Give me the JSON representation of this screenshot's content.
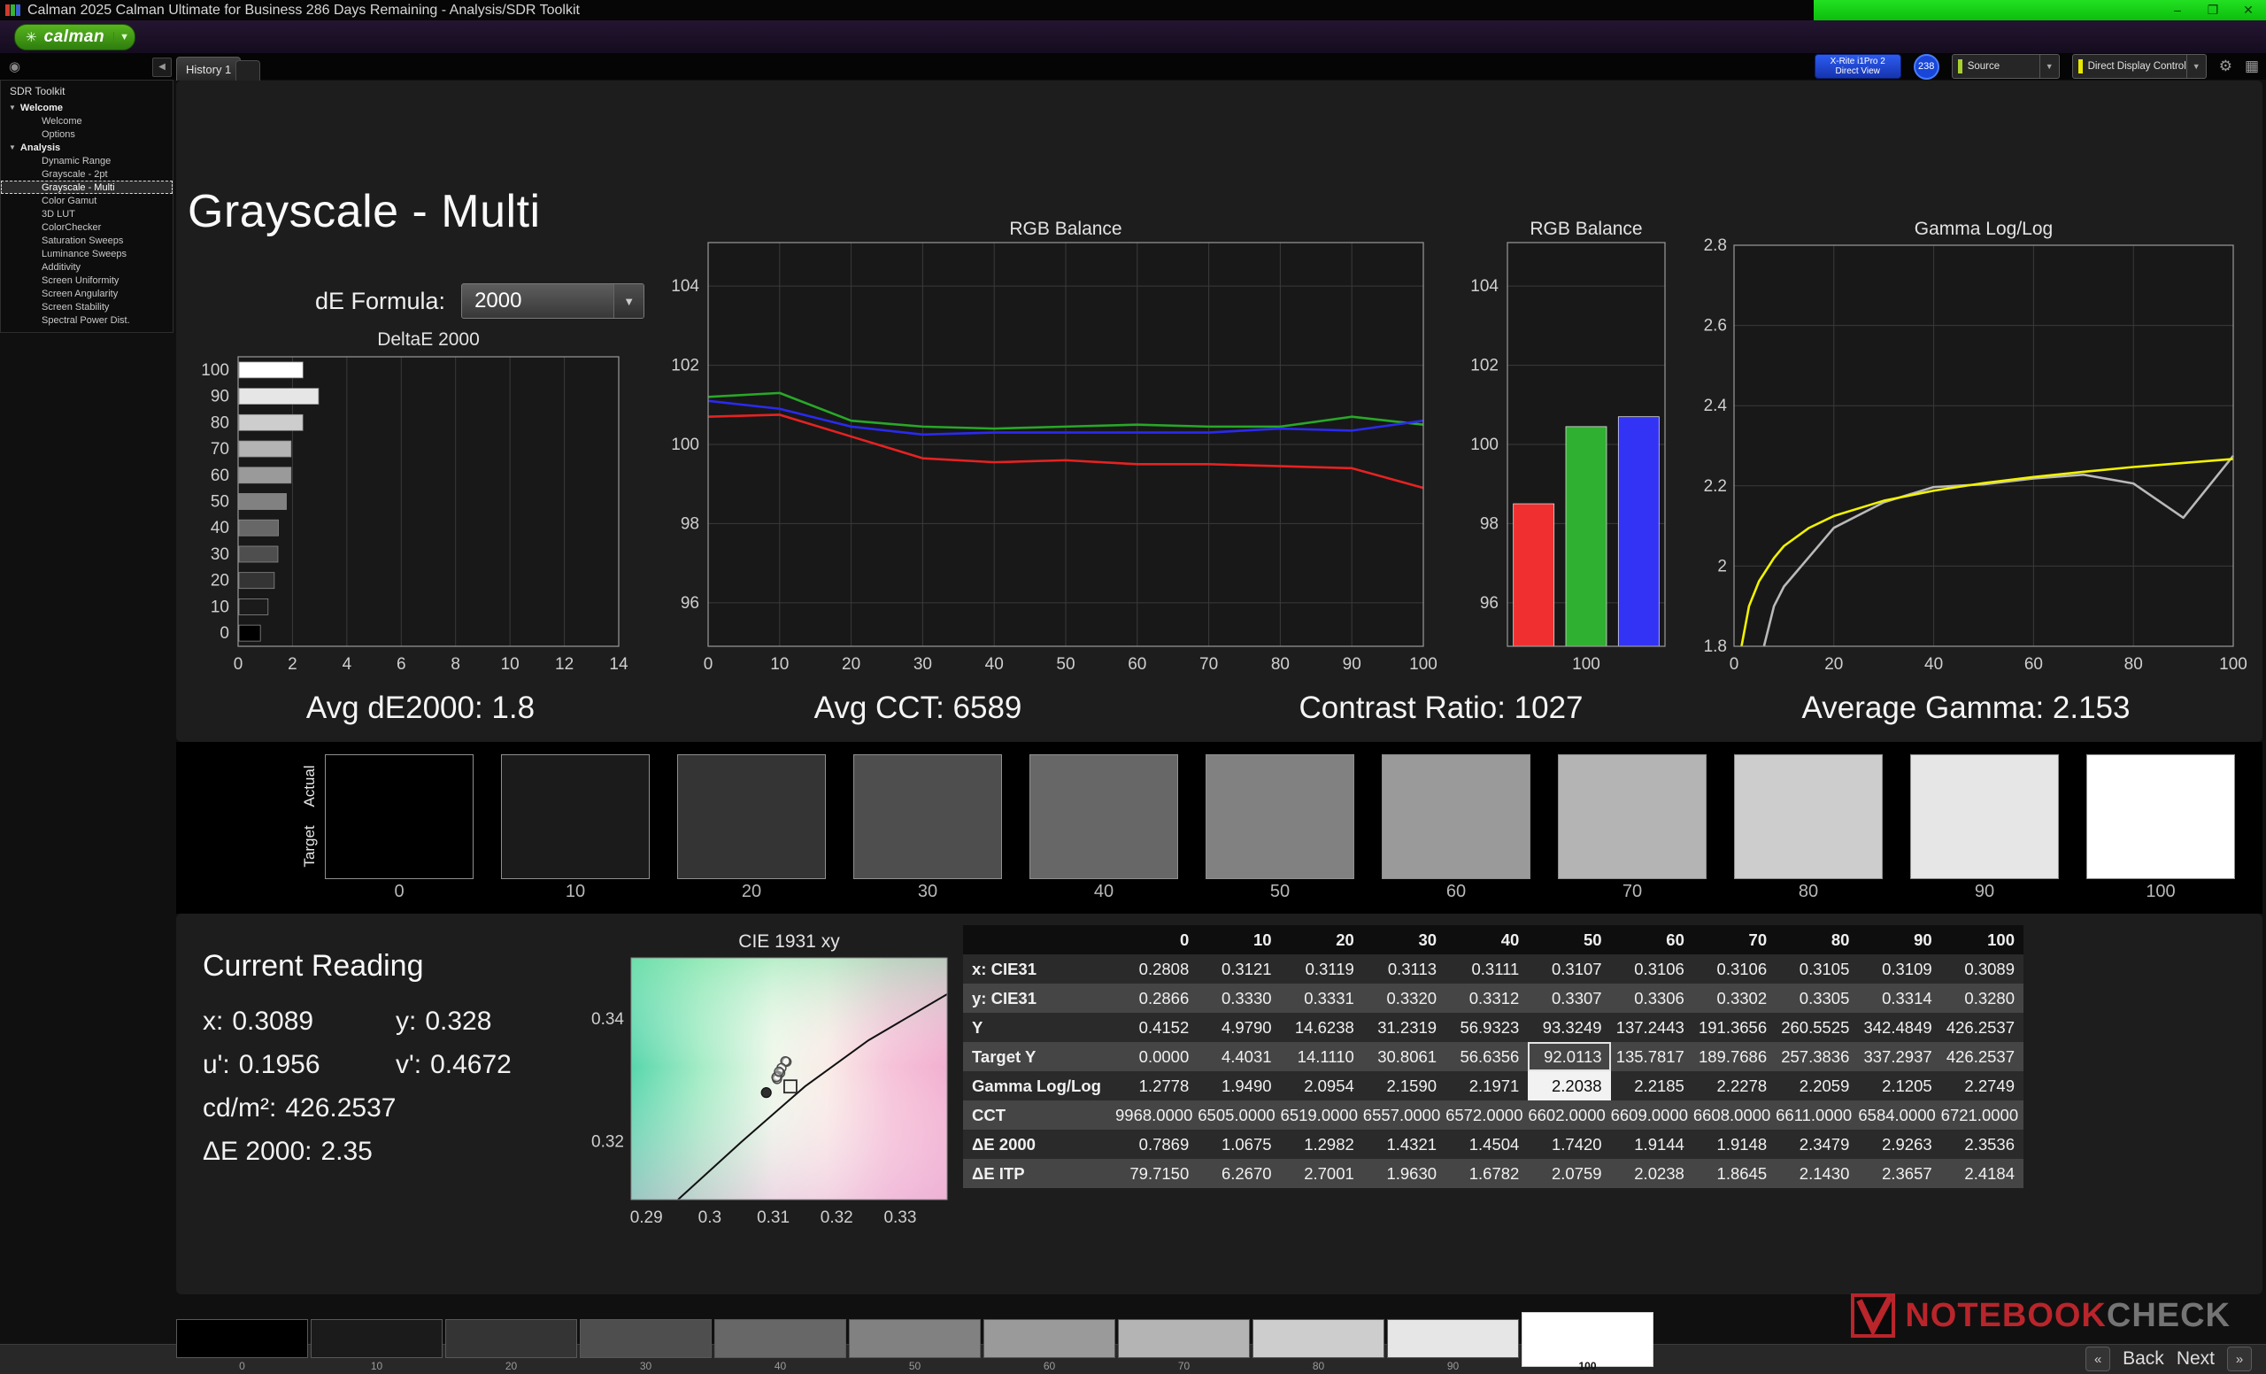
{
  "window": {
    "title": "Calman 2025 Calman Ultimate for Business 286 Days Remaining  - Analysis/SDR Toolkit",
    "minimize_glyph": "–",
    "maximize_glyph": "❐",
    "close_glyph": "✕"
  },
  "brand": {
    "logo_text": "calman",
    "accent_green": "#47a718"
  },
  "toolbar": {
    "history_tab": "History 1",
    "meter_button": {
      "line1": "X-Rite i1Pro 2",
      "line2": "Direct View"
    },
    "meter_badge": "238",
    "source_dropdown": "Source",
    "display_control_dropdown": "Direct Display Control",
    "source_indicator_color": "#a8d030",
    "display_indicator_color": "#e8e800"
  },
  "sidebar": {
    "title": "SDR Toolkit",
    "sections": [
      {
        "label": "Welcome",
        "items": [
          {
            "label": "Welcome"
          },
          {
            "label": "Options"
          }
        ]
      },
      {
        "label": "Analysis",
        "items": [
          {
            "label": "Dynamic Range"
          },
          {
            "label": "Grayscale - 2pt"
          },
          {
            "label": "Grayscale - Multi",
            "selected": true
          },
          {
            "label": "Color Gamut"
          },
          {
            "label": "3D LUT"
          },
          {
            "label": "ColorChecker"
          },
          {
            "label": "Saturation Sweeps"
          },
          {
            "label": "Luminance Sweeps"
          },
          {
            "label": "Additivity"
          },
          {
            "label": "Screen Uniformity"
          },
          {
            "label": "Screen Angularity"
          },
          {
            "label": "Screen Stability"
          },
          {
            "label": "Spectral Power Dist."
          }
        ]
      }
    ]
  },
  "page": {
    "title": "Grayscale - Multi",
    "de_formula_label": "dE Formula:",
    "de_formula_value": "2000"
  },
  "stats": [
    "Avg dE2000: 1.8",
    "Avg CCT: 6589",
    "Contrast Ratio: 1027",
    "Average Gamma: 2.153"
  ],
  "grayscale_strip": {
    "row_labels": [
      "Actual",
      "Target"
    ],
    "levels": [
      "0",
      "10",
      "20",
      "30",
      "40",
      "50",
      "60",
      "70",
      "80",
      "90",
      "100"
    ],
    "colors": [
      "#000000",
      "#1b1b1b",
      "#343434",
      "#4e4e4e",
      "#676767",
      "#818181",
      "#9a9a9a",
      "#b4b4b4",
      "#cdcdcd",
      "#e6e6e6",
      "#ffffff"
    ],
    "selected_level": "100"
  },
  "current_reading": {
    "title": "Current Reading",
    "rows": [
      [
        {
          "label": "x:",
          "value": "0.3089"
        },
        {
          "label": "y:",
          "value": "0.328"
        }
      ],
      [
        {
          "label": "u':",
          "value": "0.1956"
        },
        {
          "label": "v':",
          "value": "0.4672"
        }
      ],
      [
        {
          "label": "cd/m²:",
          "value": "426.2537"
        }
      ],
      [
        {
          "label": "ΔE 2000:",
          "value": "2.35"
        }
      ]
    ]
  },
  "table": {
    "columns": [
      "",
      "0",
      "10",
      "20",
      "30",
      "40",
      "50",
      "60",
      "70",
      "80",
      "90",
      "100"
    ],
    "rows": [
      {
        "label": "x: CIE31",
        "values": [
          "0.2808",
          "0.3121",
          "0.3119",
          "0.3113",
          "0.3111",
          "0.3107",
          "0.3106",
          "0.3106",
          "0.3105",
          "0.3109",
          "0.3089"
        ]
      },
      {
        "label": "y: CIE31",
        "values": [
          "0.2866",
          "0.3330",
          "0.3331",
          "0.3320",
          "0.3312",
          "0.3307",
          "0.3306",
          "0.3302",
          "0.3305",
          "0.3314",
          "0.3280"
        ]
      },
      {
        "label": "Y",
        "values": [
          "0.4152",
          "4.9790",
          "14.6238",
          "31.2319",
          "56.9323",
          "93.3249",
          "137.2443",
          "191.3656",
          "260.5525",
          "342.4849",
          "426.2537"
        ]
      },
      {
        "label": "Target Y",
        "values": [
          "0.0000",
          "4.4031",
          "14.1110",
          "30.8061",
          "56.6356",
          "92.0113",
          "135.7817",
          "189.7686",
          "257.3836",
          "337.2937",
          "426.2537"
        ]
      },
      {
        "label": "Gamma Log/Log",
        "values": [
          "1.2778",
          "1.9490",
          "2.0954",
          "2.1590",
          "2.1971",
          "2.2038",
          "2.2185",
          "2.2278",
          "2.2059",
          "2.1205",
          "2.2749"
        ]
      },
      {
        "label": "CCT",
        "values": [
          "9968.0000",
          "6505.0000",
          "6519.0000",
          "6557.0000",
          "6572.0000",
          "6602.0000",
          "6609.0000",
          "6608.0000",
          "6611.0000",
          "6584.0000",
          "6721.0000"
        ]
      },
      {
        "label": "ΔE 2000",
        "values": [
          "0.7869",
          "1.0675",
          "1.2982",
          "1.4321",
          "1.4504",
          "1.7420",
          "1.9144",
          "1.9148",
          "2.3479",
          "2.9263",
          "2.3536"
        ]
      },
      {
        "label": "ΔE ITP",
        "values": [
          "79.7150",
          "6.2670",
          "2.7001",
          "1.9630",
          "1.6782",
          "2.0759",
          "2.0238",
          "1.8645",
          "2.1430",
          "2.3657",
          "2.4184"
        ]
      }
    ],
    "highlights": [
      {
        "row": 3,
        "col": 5,
        "style": "outline"
      },
      {
        "row": 4,
        "col": 5,
        "style": "solid"
      }
    ]
  },
  "footer": {
    "back_label": "Back",
    "next_label": "Next"
  },
  "watermark": {
    "part1": "NOTEBOOK",
    "part2": "CHECK"
  },
  "chart_data": [
    {
      "id": "deltae",
      "type": "bar",
      "orientation": "horizontal",
      "title": "DeltaE 2000",
      "categories": [
        "100",
        "90",
        "80",
        "70",
        "60",
        "50",
        "40",
        "30",
        "20",
        "10",
        "0"
      ],
      "values": [
        2.3536,
        2.9263,
        2.3479,
        1.9148,
        1.9144,
        1.742,
        1.4504,
        1.4321,
        1.2982,
        1.0675,
        0.7869
      ],
      "xlim": [
        0,
        14
      ],
      "xticks": [
        0,
        2,
        4,
        6,
        8,
        10,
        12,
        14
      ],
      "xlabel": "",
      "ylabel": ""
    },
    {
      "id": "rgb-line",
      "type": "line",
      "title": "RGB Balance",
      "x": [
        0,
        10,
        20,
        30,
        40,
        50,
        60,
        70,
        80,
        90,
        100
      ],
      "series": [
        {
          "name": "Red",
          "color": "#e62222",
          "values": [
            100.7,
            100.75,
            100.2,
            99.65,
            99.55,
            99.6,
            99.5,
            99.5,
            99.45,
            99.4,
            98.9
          ]
        },
        {
          "name": "Green",
          "color": "#28a828",
          "values": [
            101.2,
            101.3,
            100.6,
            100.45,
            100.4,
            100.45,
            100.5,
            100.45,
            100.45,
            100.7,
            100.5
          ]
        },
        {
          "name": "Blue",
          "color": "#2a2af0",
          "values": [
            101.1,
            100.9,
            100.45,
            100.25,
            100.3,
            100.3,
            100.3,
            100.3,
            100.4,
            100.35,
            100.6
          ]
        }
      ],
      "ylim": [
        94.9,
        105.1
      ],
      "yticks": [
        96,
        98,
        100,
        102,
        104
      ],
      "xticks": [
        0,
        10,
        20,
        30,
        40,
        50,
        60,
        70,
        80,
        90,
        100
      ]
    },
    {
      "id": "rgb-bar",
      "type": "bar",
      "title": "RGB Balance",
      "categories": [
        "Red",
        "Green",
        "Blue"
      ],
      "values": [
        98.5,
        100.45,
        100.7
      ],
      "colors": [
        "#f03030",
        "#30b030",
        "#3333f5"
      ],
      "ylim": [
        94.9,
        105.1
      ],
      "yticks": [
        96,
        98,
        100,
        102,
        104
      ],
      "x_axis_label": "100"
    },
    {
      "id": "gamma",
      "type": "line",
      "title": "Gamma Log/Log",
      "series": [
        {
          "name": "Measured",
          "color": "#b9b9b9",
          "points": [
            [
              6,
              1.8
            ],
            [
              8,
              1.9
            ],
            [
              10,
              1.949
            ],
            [
              20,
              2.0954
            ],
            [
              30,
              2.159
            ],
            [
              40,
              2.1971
            ],
            [
              50,
              2.2038
            ],
            [
              60,
              2.2185
            ],
            [
              70,
              2.2278
            ],
            [
              80,
              2.2059
            ],
            [
              90,
              2.1205
            ],
            [
              100,
              2.2749
            ]
          ]
        },
        {
          "name": "Target",
          "color": "#f2f200",
          "points": [
            [
              1.5,
              1.8
            ],
            [
              3,
              1.9
            ],
            [
              5,
              1.962
            ],
            [
              8,
              2.02
            ],
            [
              10,
              2.05
            ],
            [
              15,
              2.095
            ],
            [
              20,
              2.125
            ],
            [
              30,
              2.163
            ],
            [
              40,
              2.188
            ],
            [
              50,
              2.207
            ],
            [
              60,
              2.222
            ],
            [
              70,
              2.235
            ],
            [
              80,
              2.247
            ],
            [
              90,
              2.257
            ],
            [
              100,
              2.267
            ]
          ]
        }
      ],
      "xlim": [
        0,
        100
      ],
      "ylim": [
        1.8,
        2.8
      ],
      "yticks": [
        1.8,
        2,
        2.2,
        2.4,
        2.6,
        2.8
      ],
      "xticks": [
        0,
        20,
        40,
        60,
        80,
        100
      ]
    },
    {
      "id": "cie",
      "type": "scatter",
      "title": "CIE 1931 xy",
      "xlim": [
        0.2876,
        0.3374
      ],
      "ylim": [
        0.3106,
        0.3499
      ],
      "xticks": [
        {
          "v": 0.29,
          "label": "0.29"
        },
        {
          "v": 0.3,
          "label": "0.3"
        },
        {
          "v": 0.31,
          "label": "0.31"
        },
        {
          "v": 0.32,
          "label": "0.32"
        },
        {
          "v": 0.33,
          "label": "0.33"
        }
      ],
      "yticks": [
        {
          "v": 0.34,
          "label": "0.34"
        },
        {
          "v": 0.32,
          "label": "0.32"
        }
      ],
      "points": [
        [
          0.3121,
          0.333
        ],
        [
          0.3119,
          0.3331
        ],
        [
          0.3113,
          0.332
        ],
        [
          0.3111,
          0.3312
        ],
        [
          0.3107,
          0.3307
        ],
        [
          0.3106,
          0.3306
        ],
        [
          0.3106,
          0.3302
        ],
        [
          0.3105,
          0.3305
        ],
        [
          0.3109,
          0.3314
        ]
      ],
      "current": [
        0.3089,
        0.328
      ],
      "target": [
        0.3127,
        0.329
      ],
      "locus": [
        [
          0.295,
          0.3106
        ],
        [
          0.305,
          0.32
        ],
        [
          0.315,
          0.329
        ],
        [
          0.325,
          0.3365
        ],
        [
          0.3374,
          0.344
        ]
      ]
    }
  ]
}
